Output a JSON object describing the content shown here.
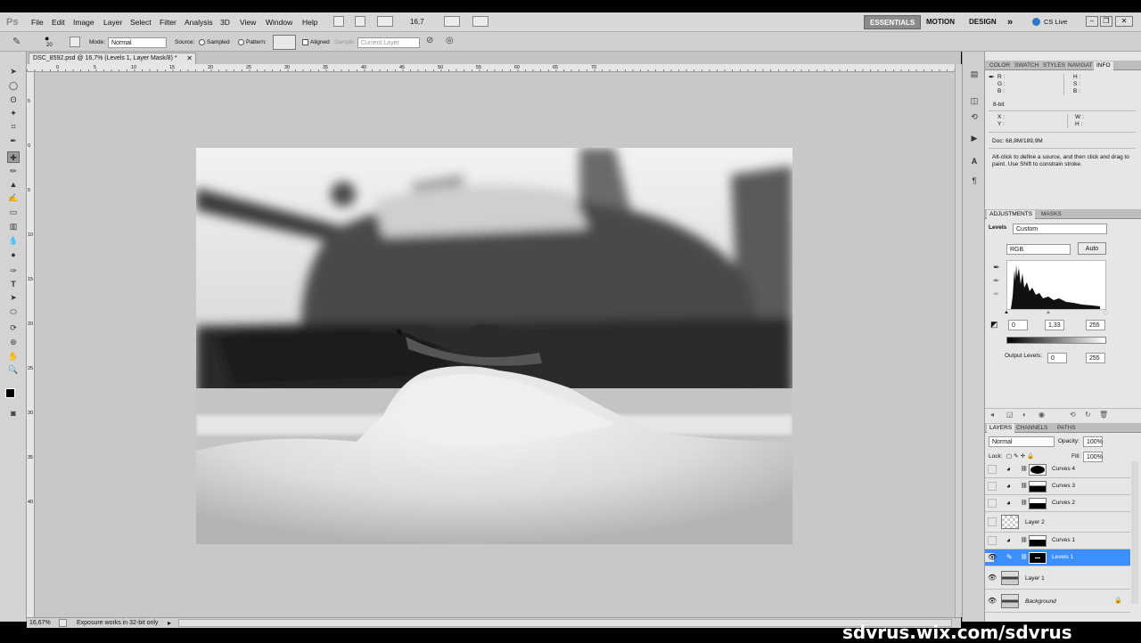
{
  "app": {
    "logo": "Ps"
  },
  "menu": {
    "items": [
      "File",
      "Edit",
      "Image",
      "Layer",
      "Select",
      "Filter",
      "Analysis",
      "3D",
      "View",
      "Window",
      "Help"
    ],
    "zoom": "16,7"
  },
  "workspaces": {
    "essentials": "ESSENTIALS",
    "motion": "MOTION",
    "design": "DESIGN",
    "more": "»",
    "cslive": "CS Live"
  },
  "options": {
    "brush_size": "20",
    "mode_label": "Mode:",
    "mode_value": "Normal",
    "source_label": "Source:",
    "sampled": "Sampled",
    "pattern": "Pattern:",
    "aligned": "Aligned",
    "sample_label": "Sample:",
    "sample_value": "Current Layer"
  },
  "document": {
    "tab_title": "DSC_8592.psd @ 16,7% (Levels 1, Layer Mask/8) *",
    "zoom_status": "16,67%",
    "status_text": "Exposure works in 32-bit only"
  },
  "ruler": {
    "h": [
      "0",
      "5",
      "10",
      "15",
      "20",
      "25",
      "30",
      "35",
      "40",
      "45",
      "50",
      "55",
      "60",
      "65",
      "70"
    ],
    "v": [
      "5",
      "0",
      "5",
      "10",
      "15",
      "20",
      "25",
      "30",
      "35",
      "40"
    ]
  },
  "info_panel": {
    "tabs": [
      "COLOR",
      "SWATCH",
      "STYLES",
      "NAVIGAT",
      "INFO"
    ],
    "r": "R :",
    "g": "G :",
    "b": "B :",
    "h": "H :",
    "s": "S :",
    "b2": "B :",
    "bit": "8-bit",
    "x": "X :",
    "y": "Y :",
    "w": "W :",
    "hh": "H :",
    "doc": "Doc: 68,8M/189,9M",
    "hint": "Alt-click to define a source, and then click and drag to paint. Use Shift to constrain stroke."
  },
  "adjustments": {
    "tabs": [
      "ADJUSTMENTS",
      "MASKS"
    ],
    "type": "Levels",
    "preset": "Custom",
    "channel": "RGB",
    "auto": "Auto",
    "input_black": "0",
    "input_gamma": "1,33",
    "input_white": "255",
    "output_label": "Output Levels:",
    "output_black": "0",
    "output_white": "255"
  },
  "layers_panel": {
    "tabs": [
      "LAYERS",
      "CHANNELS",
      "PATHS"
    ],
    "blend": "Normal",
    "opacity_label": "Opacity:",
    "opacity": "100%",
    "lock_label": "Lock:",
    "fill_label": "Fill:",
    "fill": "100%",
    "layers": [
      {
        "name": "Curves 4",
        "visible": false,
        "selected": false
      },
      {
        "name": "Curves 3",
        "visible": false,
        "selected": false
      },
      {
        "name": "Curves 2",
        "visible": false,
        "selected": false
      },
      {
        "name": "Layer 2",
        "visible": false,
        "selected": false
      },
      {
        "name": "Curves 1",
        "visible": false,
        "selected": false
      },
      {
        "name": "Levels 1",
        "visible": true,
        "selected": true
      },
      {
        "name": "Layer 1",
        "visible": true,
        "selected": false
      },
      {
        "name": "Background",
        "visible": true,
        "selected": false
      }
    ]
  },
  "watermark": "sdvrus.wix.com/sdvrus",
  "colors": {
    "accent": "#3d8eff",
    "selected_layer": "#3d8eff"
  }
}
